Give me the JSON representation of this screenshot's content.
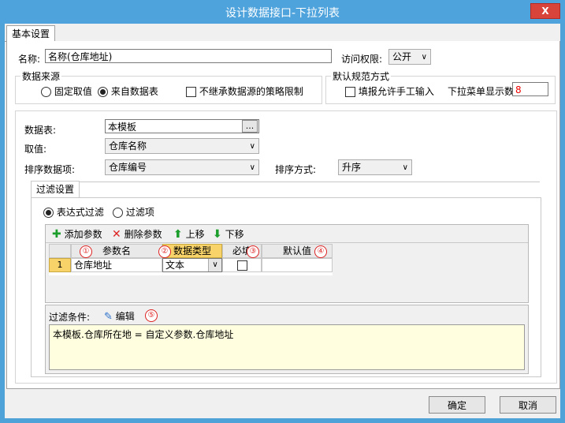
{
  "window": {
    "title": "设计数据接口-下拉列表",
    "close": "X"
  },
  "tabs": {
    "basic": "基本设置"
  },
  "name": {
    "label": "名称:",
    "value": "名称(仓库地址)"
  },
  "access": {
    "label": "访问权限:",
    "value": "公开"
  },
  "source": {
    "legend": "数据来源",
    "fixed": "固定取值",
    "from_table": "来自数据表",
    "no_inherit": "不继承数据源的策略限制"
  },
  "defaults": {
    "legend": "默认规范方式",
    "allow_manual": "填报允许手工输入",
    "dropdown_count_label": "下拉菜单显示数",
    "dropdown_count": "8"
  },
  "table": {
    "table_label": "数据表:",
    "table_value": "本模板",
    "browse": "...",
    "value_label": "取值:",
    "value_value": "仓库名称",
    "sort_field_label": "排序数据项:",
    "sort_field_value": "仓库编号",
    "sort_mode_label": "排序方式:",
    "sort_mode_value": "升序"
  },
  "filter": {
    "tab": "过滤设置",
    "expr": "表达式过滤",
    "item": "过滤项",
    "add": "添加参数",
    "del": "删除参数",
    "up": "上移",
    "down": "下移",
    "headers": [
      "参数名",
      "数据类型",
      "必填",
      "默认值"
    ],
    "badges": [
      "①",
      "②",
      "③",
      "④",
      "⑤"
    ],
    "row": {
      "idx": "1",
      "name": "仓库地址",
      "type": "文本"
    },
    "cond_label": "过滤条件:",
    "edit": "编辑",
    "expression": "本模板.仓库所在地 = 自定义参数.仓库地址"
  },
  "footer": {
    "ok": "确定",
    "cancel": "取消"
  }
}
